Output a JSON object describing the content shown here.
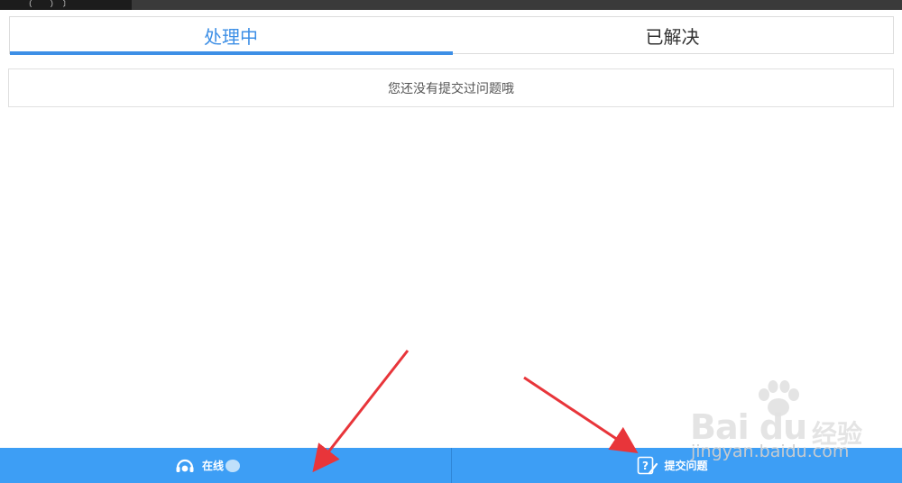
{
  "tabs": {
    "processing": "处理中",
    "resolved": "已解决",
    "active": "processing"
  },
  "content": {
    "empty_message": "您还没有提交过问题哦"
  },
  "bottom_bar": {
    "online_label": "在线",
    "submit_label": "提交问题"
  },
  "watermark": {
    "brand": "Bai du",
    "brand_suffix": "经验",
    "url": "jingyan.baidu.com"
  },
  "colors": {
    "accent": "#3d8fe6",
    "bottom_bar": "#3d9ef5",
    "annotation_arrow": "#e8353a"
  }
}
